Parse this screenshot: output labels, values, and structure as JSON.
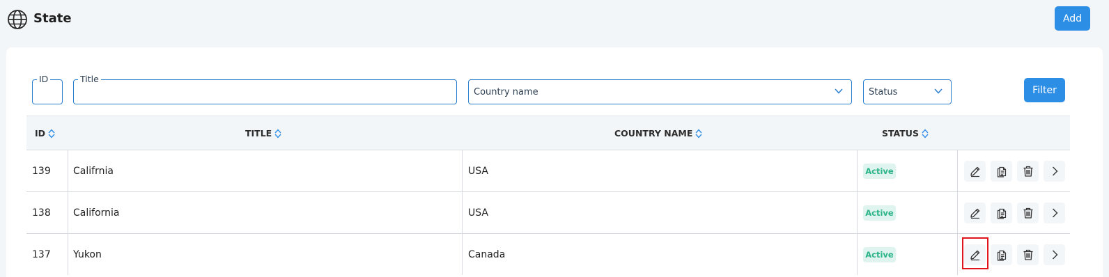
{
  "header": {
    "title": "State",
    "add_label": "Add"
  },
  "filters": {
    "id_label": "ID",
    "title_label": "Title",
    "country_placeholder": "Country name",
    "status_placeholder": "Status",
    "filter_label": "Filter"
  },
  "table": {
    "columns": [
      "ID",
      "TITLE",
      "COUNTRY NAME",
      "STATUS"
    ],
    "rows": [
      {
        "id": "139",
        "title": "Califrnia",
        "country": "USA",
        "status": "Active"
      },
      {
        "id": "138",
        "title": "California",
        "country": "USA",
        "status": "Active"
      },
      {
        "id": "137",
        "title": "Yukon",
        "country": "Canada",
        "status": "Active"
      }
    ]
  },
  "colors": {
    "primary": "#2d8ee6",
    "active_badge_bg": "#dff4ef",
    "active_badge_text": "#2bb48a",
    "highlight": "#e0141a"
  },
  "icons": {
    "header": "globe-icon",
    "row_actions": [
      "edit-icon",
      "copy-icon",
      "delete-icon",
      "chevron-right-icon"
    ]
  }
}
